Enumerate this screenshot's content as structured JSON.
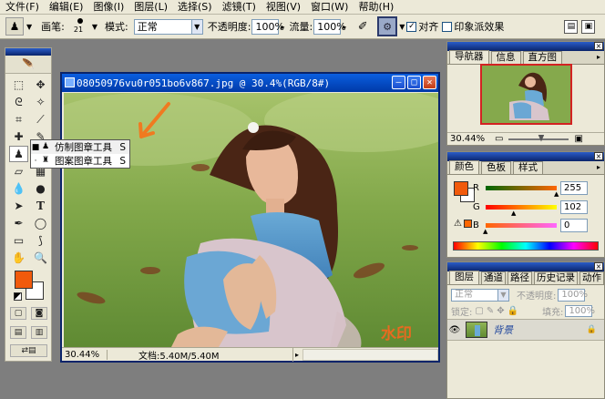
{
  "menubar": {
    "items": [
      "文件(F)",
      "编辑(E)",
      "图像(I)",
      "图层(L)",
      "选择(S)",
      "滤镜(T)",
      "视图(V)",
      "窗口(W)",
      "帮助(H)"
    ]
  },
  "options_bar": {
    "brush_label": "画笔:",
    "brush_size": "21",
    "mode_label": "模式:",
    "mode_value": "正常",
    "opacity_label": "不透明度:",
    "opacity_value": "100%",
    "flow_label": "流量:",
    "flow_value": "100%",
    "aligned_label": "对齐",
    "aligned_checked": true,
    "impressionist_label": "印象派效果",
    "impressionist_checked": false
  },
  "document": {
    "title": "08050976vu0r051bo6v867.jpg @ 30.4%(RGB/8#)",
    "zoom": "30.44%",
    "doc_info": "文档:5.40M/5.40M",
    "watermark": "水印"
  },
  "tool_popup": {
    "items": [
      {
        "label": "仿制图章工具",
        "key": "S",
        "selected": true
      },
      {
        "label": "图案图章工具",
        "key": "S",
        "selected": false
      }
    ]
  },
  "colors": {
    "foreground": "#f15a0c",
    "background": "#ffffff",
    "accent_arrow": "#f07a20"
  },
  "navigator_panel": {
    "tabs": [
      "导航器",
      "信息",
      "直方图"
    ],
    "zoom": "30.44%"
  },
  "color_panel": {
    "tabs": [
      "颜色",
      "色板",
      "样式"
    ],
    "channels": [
      {
        "label": "R",
        "value": "255",
        "fraction": 1.0
      },
      {
        "label": "G",
        "value": "102",
        "fraction": 0.4
      },
      {
        "label": "B",
        "value": "0",
        "fraction": 0.0
      }
    ]
  },
  "layers_panel": {
    "tabs": [
      "图层",
      "通道",
      "路径",
      "历史记录",
      "动作"
    ],
    "blend_mode": "正常",
    "opacity_label": "不透明度:",
    "opacity_value": "100%",
    "lock_label": "锁定:",
    "fill_label": "填充:",
    "fill_value": "100%",
    "layer_name": "背景"
  }
}
